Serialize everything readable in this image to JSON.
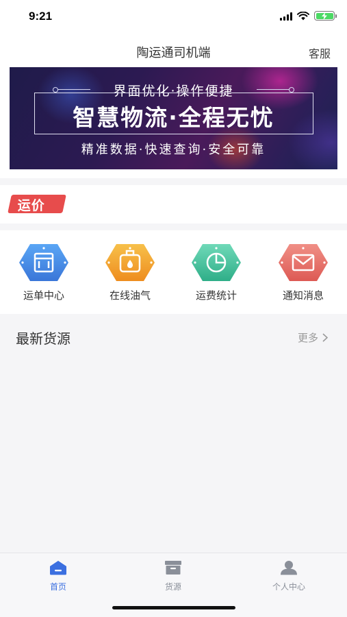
{
  "status_bar": {
    "time": "9:21"
  },
  "nav": {
    "title": "陶运通司机端",
    "action": "客服"
  },
  "banner": {
    "line1": "界面优化·操作便捷",
    "line2": "智慧物流·全程无忧",
    "line3": "精准数据·快速查询·安全可靠"
  },
  "price_section": {
    "tag": "运价"
  },
  "menu": {
    "items": [
      {
        "label": "运单中心",
        "icon": "waybill-icon",
        "color": "#4a90e2"
      },
      {
        "label": "在线油气",
        "icon": "fuel-icon",
        "color": "#f5a623"
      },
      {
        "label": "运费统计",
        "icon": "pie-chart-icon",
        "color": "#3fbf9b"
      },
      {
        "label": "通知消息",
        "icon": "mail-icon",
        "color": "#e8706b"
      }
    ]
  },
  "latest": {
    "title": "最新货源",
    "more": "更多"
  },
  "tabs": [
    {
      "label": "首页",
      "icon": "home-icon",
      "active": true
    },
    {
      "label": "货源",
      "icon": "box-icon",
      "active": false
    },
    {
      "label": "个人中心",
      "icon": "user-icon",
      "active": false
    }
  ],
  "colors": {
    "accent": "#3b6fe0",
    "tab_inactive": "#8a8f99",
    "price_tag": "#e74c4c"
  }
}
